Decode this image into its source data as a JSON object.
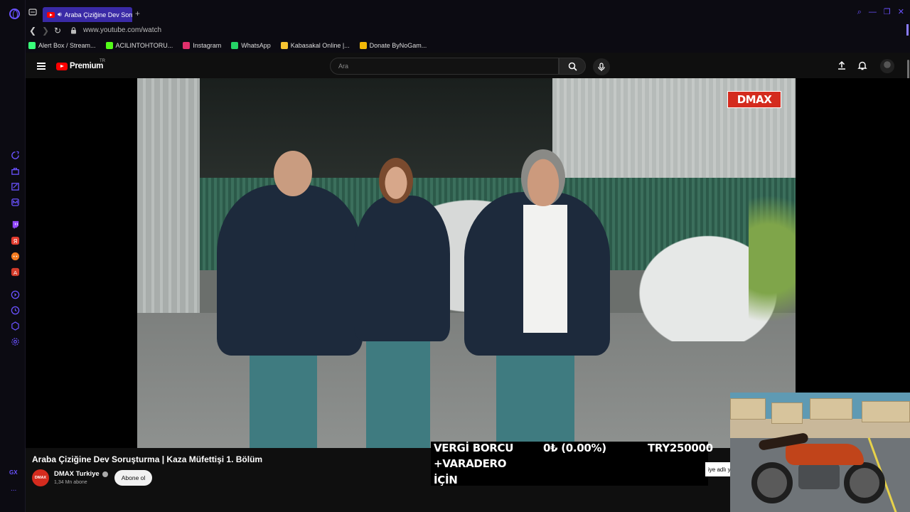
{
  "browser": {
    "tab_title": "Araba Çiziğine Dev Soru",
    "new_tab": "+",
    "url": "www.youtube.com/watch",
    "bookmarks": [
      {
        "label": "Alert Box / Stream...",
        "icon": "streamelements-icon",
        "color": "#39ff7a"
      },
      {
        "label": "ACILINTOHTORU...",
        "icon": "kick-icon",
        "color": "#53fc18"
      },
      {
        "label": "Instagram",
        "icon": "instagram-icon",
        "color": "#e1306c"
      },
      {
        "label": "WhatsApp",
        "icon": "whatsapp-icon",
        "color": "#25d366"
      },
      {
        "label": "Kabasakal Online |...",
        "icon": "kabasakal-icon",
        "color": "#f6c431"
      },
      {
        "label": "Donate ByNoGam...",
        "icon": "bynogame-icon",
        "color": "#f2b807"
      }
    ],
    "sidebar_label": "GX",
    "sidebar_more": "...",
    "accent_color": "#6a52ff"
  },
  "youtube": {
    "logo_text": "Premium",
    "country_code": "TR",
    "search_placeholder": "Ara",
    "video": {
      "channel_logo": "DMAX",
      "title": "Araba Çiziğine Dev Soruşturma | Kaza Müfettişi 1. Bölüm"
    },
    "channel": {
      "avatar_text": "DMAX",
      "name": "DMAX Turkiye",
      "subscribers": "1,34 Mn abone",
      "subscribe_label": "Abone ol"
    }
  },
  "overlay": {
    "donation_line1_left": "VERGİ BORCU",
    "donation_line1_mid": "0₺ (0.00%)",
    "donation_line1_right": "TRY250000",
    "donation_line2": "+VARADERO",
    "donation_line3": "İÇİN",
    "ticker_fragment": "iye adlı y"
  }
}
